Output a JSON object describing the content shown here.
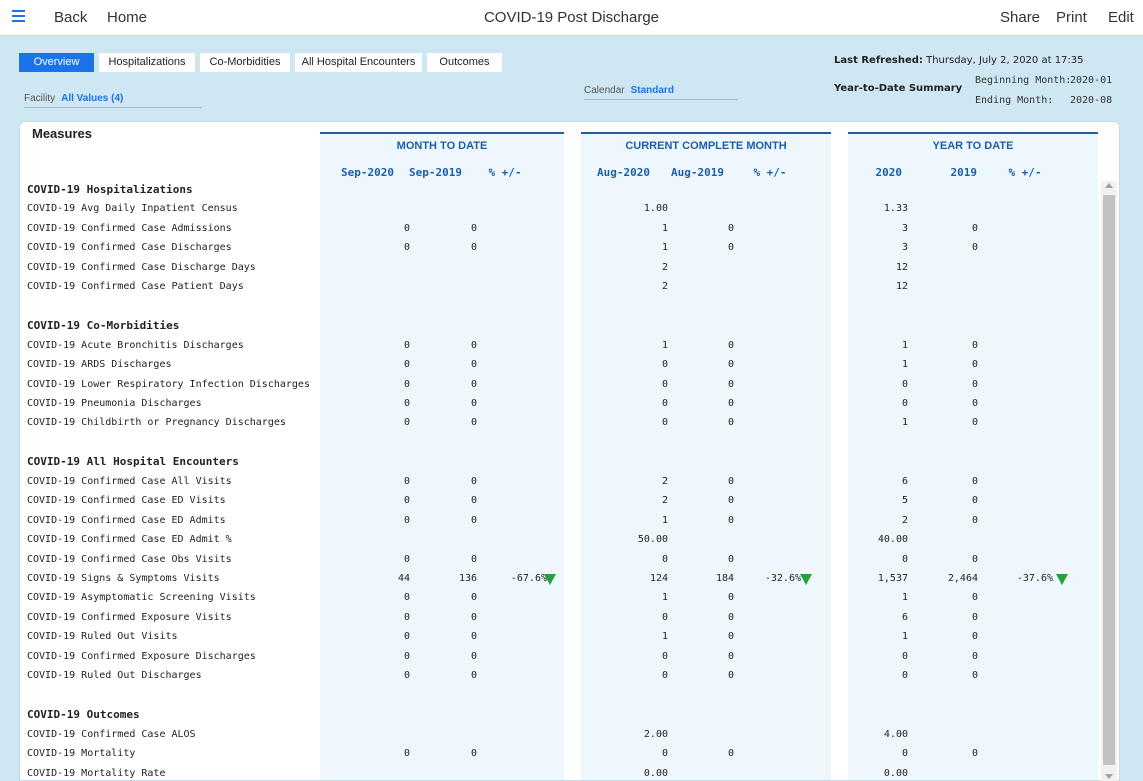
{
  "topbar": {
    "back_label": "Back",
    "home_label": "Home",
    "title": "COVID-19 Post Discharge",
    "share_label": "Share",
    "print_label": "Print",
    "edit_label": "Edit",
    "menu_icon": "hamburger-menu-icon"
  },
  "tabs": [
    {
      "label": "Overview",
      "active": true
    },
    {
      "label": "Hospitalizations",
      "active": false
    },
    {
      "label": "Co-Morbidities",
      "active": false
    },
    {
      "label": "All Hospital Encounters",
      "active": false
    },
    {
      "label": "Outcomes",
      "active": false
    }
  ],
  "filters": {
    "facility_label": "Facility",
    "facility_value": "All Values (4)",
    "calendar_label": "Calendar",
    "calendar_value": "Standard"
  },
  "refresh": {
    "label": "Last Refreshed:",
    "value": "Thursday, July 2, 2020  at 17:35"
  },
  "ytd_summary": {
    "label": "Year-to-Date Summary",
    "beginning_label": "Beginning Month:",
    "beginning_value": "2020-01",
    "ending_label": "Ending Month:",
    "ending_value": "2020-08"
  },
  "report": {
    "measures_label": "Measures",
    "groups": [
      {
        "title": "MONTH TO DATE",
        "columns": [
          "Sep-2020",
          "Sep-2019",
          "% +/-"
        ]
      },
      {
        "title": "CURRENT COMPLETE MONTH",
        "columns": [
          "Aug-2020",
          "Aug-2019",
          "% +/-"
        ]
      },
      {
        "title": "YEAR TO DATE",
        "columns": [
          "2020",
          "2019",
          "% +/-"
        ]
      }
    ],
    "rows": [
      {
        "type": "section",
        "label": "COVID-19 Hospitalizations"
      },
      {
        "type": "data",
        "label": "COVID-19 Avg Daily Inpatient Census",
        "values": [
          "",
          "",
          "",
          "1.00",
          "",
          "",
          "1.33",
          "",
          ""
        ]
      },
      {
        "type": "data",
        "label": "COVID-19 Confirmed Case Admissions",
        "values": [
          "0",
          "0",
          "",
          "1",
          "0",
          "",
          "3",
          "0",
          ""
        ]
      },
      {
        "type": "data",
        "label": "COVID-19 Confirmed Case Discharges",
        "values": [
          "0",
          "0",
          "",
          "1",
          "0",
          "",
          "3",
          "0",
          ""
        ]
      },
      {
        "type": "data",
        "label": "COVID-19 Confirmed Case Discharge Days",
        "values": [
          "",
          "",
          "",
          "2",
          "",
          "",
          "12",
          "",
          ""
        ]
      },
      {
        "type": "data",
        "label": "COVID-19 Confirmed Case Patient Days",
        "values": [
          "",
          "",
          "",
          "2",
          "",
          "",
          "12",
          "",
          ""
        ]
      },
      {
        "type": "blank"
      },
      {
        "type": "section",
        "label": "COVID-19 Co-Morbidities"
      },
      {
        "type": "data",
        "label": "COVID-19 Acute Bronchitis Discharges",
        "values": [
          "0",
          "0",
          "",
          "1",
          "0",
          "",
          "1",
          "0",
          ""
        ]
      },
      {
        "type": "data",
        "label": "COVID-19 ARDS Discharges",
        "values": [
          "0",
          "0",
          "",
          "0",
          "0",
          "",
          "1",
          "0",
          ""
        ]
      },
      {
        "type": "data",
        "label": "COVID-19 Lower Respiratory Infection Discharges",
        "values": [
          "0",
          "0",
          "",
          "0",
          "0",
          "",
          "0",
          "0",
          ""
        ]
      },
      {
        "type": "data",
        "label": "COVID-19 Pneumonia Discharges",
        "values": [
          "0",
          "0",
          "",
          "0",
          "0",
          "",
          "0",
          "0",
          ""
        ]
      },
      {
        "type": "data",
        "label": "COVID-19 Childbirth or Pregnancy Discharges",
        "values": [
          "0",
          "0",
          "",
          "0",
          "0",
          "",
          "1",
          "0",
          ""
        ]
      },
      {
        "type": "blank"
      },
      {
        "type": "section",
        "label": "COVID-19 All Hospital Encounters"
      },
      {
        "type": "data",
        "label": "COVID-19 Confirmed Case All Visits",
        "values": [
          "0",
          "0",
          "",
          "2",
          "0",
          "",
          "6",
          "0",
          ""
        ]
      },
      {
        "type": "data",
        "label": "COVID-19 Confirmed Case ED Visits",
        "values": [
          "0",
          "0",
          "",
          "2",
          "0",
          "",
          "5",
          "0",
          ""
        ]
      },
      {
        "type": "data",
        "label": "COVID-19 Confirmed Case ED Admits",
        "values": [
          "0",
          "0",
          "",
          "1",
          "0",
          "",
          "2",
          "0",
          ""
        ]
      },
      {
        "type": "data",
        "label": "COVID-19 Confirmed Case ED Admit %",
        "values": [
          "",
          "",
          "",
          "50.00",
          "",
          "",
          "40.00",
          "",
          ""
        ]
      },
      {
        "type": "data",
        "label": "COVID-19 Confirmed Case Obs Visits",
        "values": [
          "0",
          "0",
          "",
          "0",
          "0",
          "",
          "0",
          "0",
          ""
        ]
      },
      {
        "type": "data",
        "label": "COVID-19 Signs & Symptoms Visits",
        "values": [
          "44",
          "136",
          "-67.6%",
          "124",
          "184",
          "-32.6%",
          "1,537",
          "2,464",
          "-37.6%"
        ],
        "trend": [
          "down",
          "down",
          "down"
        ]
      },
      {
        "type": "data",
        "label": "COVID-19 Asymptomatic Screening Visits",
        "values": [
          "0",
          "0",
          "",
          "1",
          "0",
          "",
          "1",
          "0",
          ""
        ]
      },
      {
        "type": "data",
        "label": "COVID-19 Confirmed Exposure Visits",
        "values": [
          "0",
          "0",
          "",
          "0",
          "0",
          "",
          "6",
          "0",
          ""
        ]
      },
      {
        "type": "data",
        "label": "COVID-19 Ruled Out Visits",
        "values": [
          "0",
          "0",
          "",
          "1",
          "0",
          "",
          "1",
          "0",
          ""
        ]
      },
      {
        "type": "data",
        "label": "COVID-19 Confirmed Exposure Discharges",
        "values": [
          "0",
          "0",
          "",
          "0",
          "0",
          "",
          "0",
          "0",
          ""
        ]
      },
      {
        "type": "data",
        "label": "COVID-19 Ruled Out Discharges",
        "values": [
          "0",
          "0",
          "",
          "0",
          "0",
          "",
          "0",
          "0",
          ""
        ]
      },
      {
        "type": "blank"
      },
      {
        "type": "section",
        "label": "COVID-19 Outcomes"
      },
      {
        "type": "data",
        "label": "COVID-19 Confirmed Case ALOS",
        "values": [
          "",
          "",
          "",
          "2.00",
          "",
          "",
          "4.00",
          "",
          ""
        ]
      },
      {
        "type": "data",
        "label": "COVID-19 Mortality",
        "values": [
          "0",
          "0",
          "",
          "0",
          "0",
          "",
          "0",
          "0",
          ""
        ]
      },
      {
        "type": "data",
        "label": "COVID-19 Mortality Rate",
        "values": [
          "",
          "",
          "",
          "0.00",
          "",
          "",
          "0.00",
          "",
          ""
        ]
      }
    ]
  },
  "colors": {
    "accent": "#1a73e8",
    "header_blue": "#1a5fa8",
    "band": "#cfe7f2",
    "trend_down": "#22a33a"
  },
  "icons": {
    "trend_down": "green-down-triangle-icon"
  }
}
